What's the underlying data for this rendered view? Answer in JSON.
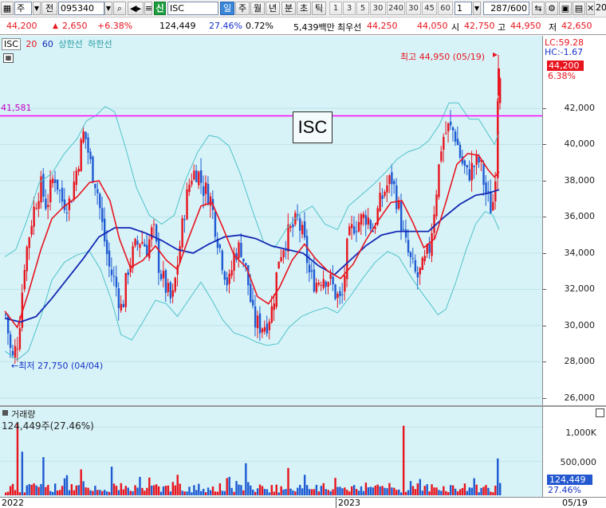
{
  "toolbar": {
    "market": "주",
    "prev_label": "전",
    "code": "095340",
    "name_tag": "신",
    "name": "ISC",
    "periods": [
      "일",
      "주",
      "월",
      "년",
      "분",
      "초",
      "틱"
    ],
    "active_period": "일",
    "numbers": [
      "1",
      "3",
      "5",
      "30",
      "240",
      "30",
      "45",
      "60"
    ],
    "unit": "1",
    "page_count": "287/600",
    "right_edge": "20"
  },
  "quote": {
    "price": "44,200",
    "change": "2,650",
    "change_pct": "+6.38%",
    "volume": "124,449",
    "vol_ratio": "27.46%",
    "turnover_pct": "0.72%",
    "amount": "5,439백만",
    "best_bid_label": "최우선",
    "best_ask": "44,250",
    "best_bid": "44,050",
    "open_label": "시",
    "open": "42,750",
    "high_label": "고",
    "high": "44,950",
    "low_label": "저",
    "low": "42,650"
  },
  "legend": {
    "name": "ISC",
    "ma1": "20",
    "ma2": "60",
    "upper": "상한선",
    "lower": "하한선"
  },
  "chart_title": "ISC",
  "right_info": {
    "lc": "LC:59.28",
    "hc": "HC:-1.67"
  },
  "price_badge": {
    "price": "44,200",
    "pct": "6.38%"
  },
  "annotations": {
    "high": "최고 44,950 (05/19)",
    "low": "최저 27,750 (04/04)",
    "line_label": "41,581"
  },
  "volume_legend": {
    "title": "거래량",
    "value": "124,449주(27.46%)"
  },
  "volume_badge": {
    "value": "124,449",
    "pct": "27.46%"
  },
  "volume_axis": [
    "1,000K",
    "500,000",
    "0"
  ],
  "date_labels": [
    "2022",
    "2023",
    "05/19"
  ],
  "colors": {
    "up": "#e8141e",
    "down": "#1e5ad2",
    "ma20": "#e8141e",
    "ma60": "#1428b4",
    "band": "#4fc3c8",
    "hline": "#ff00ff",
    "bg": "#d7f3f8"
  },
  "chart_data": {
    "type": "candlestick",
    "y_axis_labels": [
      "42,000",
      "40,000",
      "38,000",
      "36,000",
      "34,000",
      "32,000",
      "30,000",
      "28,000",
      "26,000"
    ],
    "ylim": [
      25600,
      46000
    ],
    "horizontal_line": 41581,
    "x_range": [
      "2022",
      "05/19"
    ],
    "period_high": 44950,
    "period_low": 27750,
    "close_path": [
      [
        0,
        30600
      ],
      [
        8,
        28000
      ],
      [
        16,
        29300
      ],
      [
        24,
        33500
      ],
      [
        34,
        36100
      ],
      [
        44,
        37800
      ],
      [
        52,
        36600
      ],
      [
        62,
        38400
      ],
      [
        72,
        36900
      ],
      [
        82,
        36800
      ],
      [
        92,
        39000
      ],
      [
        100,
        40800
      ],
      [
        108,
        38900
      ],
      [
        116,
        37700
      ],
      [
        124,
        35200
      ],
      [
        132,
        33200
      ],
      [
        140,
        32300
      ],
      [
        148,
        30800
      ],
      [
        156,
        33200
      ],
      [
        164,
        34200
      ],
      [
        172,
        34800
      ],
      [
        180,
        34300
      ],
      [
        188,
        35400
      ],
      [
        196,
        33100
      ],
      [
        204,
        32100
      ],
      [
        212,
        31200
      ],
      [
        220,
        33800
      ],
      [
        228,
        36400
      ],
      [
        236,
        38300
      ],
      [
        244,
        38600
      ],
      [
        252,
        37600
      ],
      [
        260,
        37200
      ],
      [
        268,
        35300
      ],
      [
        276,
        33600
      ],
      [
        284,
        32100
      ],
      [
        292,
        34100
      ],
      [
        300,
        34300
      ],
      [
        308,
        32600
      ],
      [
        316,
        30200
      ],
      [
        324,
        30000
      ],
      [
        332,
        30100
      ],
      [
        340,
        31000
      ],
      [
        348,
        33800
      ],
      [
        356,
        34700
      ],
      [
        364,
        35300
      ],
      [
        372,
        35800
      ],
      [
        380,
        34700
      ],
      [
        388,
        32600
      ],
      [
        396,
        32400
      ],
      [
        404,
        32800
      ],
      [
        412,
        32600
      ],
      [
        420,
        31800
      ],
      [
        428,
        31200
      ],
      [
        436,
        34600
      ],
      [
        444,
        35600
      ],
      [
        452,
        35800
      ],
      [
        460,
        36100
      ],
      [
        468,
        35300
      ],
      [
        476,
        36600
      ],
      [
        484,
        37600
      ],
      [
        492,
        38100
      ],
      [
        500,
        36700
      ],
      [
        508,
        34700
      ],
      [
        516,
        33500
      ],
      [
        524,
        32600
      ],
      [
        532,
        33200
      ],
      [
        540,
        34300
      ],
      [
        548,
        37200
      ],
      [
        556,
        40300
      ],
      [
        564,
        40900
      ],
      [
        572,
        40700
      ],
      [
        580,
        39200
      ],
      [
        588,
        38300
      ],
      [
        596,
        38800
      ],
      [
        604,
        39100
      ],
      [
        612,
        37300
      ],
      [
        620,
        36300
      ],
      [
        624,
        38600
      ],
      [
        628,
        44200
      ]
    ],
    "ma20_path": [
      [
        0,
        30800
      ],
      [
        16,
        29900
      ],
      [
        30,
        31800
      ],
      [
        46,
        34200
      ],
      [
        60,
        35900
      ],
      [
        76,
        36600
      ],
      [
        92,
        37100
      ],
      [
        108,
        37900
      ],
      [
        120,
        38000
      ],
      [
        134,
        36900
      ],
      [
        146,
        34800
      ],
      [
        160,
        33200
      ],
      [
        176,
        33600
      ],
      [
        192,
        34400
      ],
      [
        206,
        33600
      ],
      [
        220,
        33100
      ],
      [
        234,
        34800
      ],
      [
        250,
        36600
      ],
      [
        264,
        36800
      ],
      [
        278,
        35400
      ],
      [
        292,
        33900
      ],
      [
        308,
        33200
      ],
      [
        322,
        31600
      ],
      [
        336,
        31200
      ],
      [
        350,
        32100
      ],
      [
        366,
        33600
      ],
      [
        382,
        34500
      ],
      [
        396,
        33700
      ],
      [
        412,
        33000
      ],
      [
        428,
        32600
      ],
      [
        444,
        33400
      ],
      [
        460,
        34700
      ],
      [
        476,
        35800
      ],
      [
        492,
        36800
      ],
      [
        506,
        36900
      ],
      [
        520,
        35700
      ],
      [
        534,
        34300
      ],
      [
        548,
        34800
      ],
      [
        562,
        36800
      ],
      [
        576,
        38900
      ],
      [
        590,
        39500
      ],
      [
        604,
        39400
      ],
      [
        616,
        38600
      ],
      [
        624,
        38200
      ],
      [
        630,
        38500
      ]
    ],
    "ma60_path": [
      [
        0,
        30400
      ],
      [
        20,
        30200
      ],
      [
        40,
        30500
      ],
      [
        60,
        31500
      ],
      [
        80,
        32600
      ],
      [
        100,
        33700
      ],
      [
        120,
        34900
      ],
      [
        140,
        35400
      ],
      [
        160,
        35400
      ],
      [
        180,
        35100
      ],
      [
        200,
        34700
      ],
      [
        220,
        34200
      ],
      [
        240,
        34000
      ],
      [
        260,
        34500
      ],
      [
        280,
        34900
      ],
      [
        300,
        35000
      ],
      [
        320,
        34800
      ],
      [
        340,
        34400
      ],
      [
        360,
        34200
      ],
      [
        380,
        34000
      ],
      [
        400,
        33300
      ],
      [
        420,
        32800
      ],
      [
        440,
        33600
      ],
      [
        460,
        34400
      ],
      [
        480,
        35000
      ],
      [
        500,
        35200
      ],
      [
        520,
        35200
      ],
      [
        540,
        35200
      ],
      [
        560,
        36000
      ],
      [
        580,
        36700
      ],
      [
        600,
        37200
      ],
      [
        615,
        37300
      ],
      [
        630,
        37500
      ]
    ],
    "upper_band": [
      [
        0,
        33800
      ],
      [
        14,
        34200
      ],
      [
        28,
        35800
      ],
      [
        44,
        37900
      ],
      [
        60,
        38400
      ],
      [
        76,
        39500
      ],
      [
        92,
        40300
      ],
      [
        104,
        41300
      ],
      [
        116,
        41600
      ],
      [
        128,
        42100
      ],
      [
        140,
        41800
      ],
      [
        154,
        39800
      ],
      [
        168,
        37600
      ],
      [
        184,
        36100
      ],
      [
        200,
        35600
      ],
      [
        216,
        36100
      ],
      [
        230,
        38000
      ],
      [
        246,
        39600
      ],
      [
        260,
        40500
      ],
      [
        272,
        40400
      ],
      [
        286,
        39900
      ],
      [
        300,
        38400
      ],
      [
        316,
        36300
      ],
      [
        330,
        34600
      ],
      [
        344,
        34300
      ],
      [
        360,
        35400
      ],
      [
        376,
        36200
      ],
      [
        392,
        36600
      ],
      [
        408,
        35600
      ],
      [
        424,
        35300
      ],
      [
        438,
        36600
      ],
      [
        454,
        37200
      ],
      [
        470,
        37800
      ],
      [
        486,
        38500
      ],
      [
        500,
        39200
      ],
      [
        514,
        39600
      ],
      [
        528,
        39800
      ],
      [
        540,
        40200
      ],
      [
        554,
        41100
      ],
      [
        566,
        42300
      ],
      [
        578,
        42300
      ],
      [
        592,
        41400
      ],
      [
        604,
        41400
      ],
      [
        614,
        40700
      ],
      [
        624,
        40000
      ],
      [
        630,
        40700
      ]
    ],
    "lower_band": [
      [
        0,
        28600
      ],
      [
        16,
        28100
      ],
      [
        30,
        28600
      ],
      [
        46,
        30500
      ],
      [
        60,
        32500
      ],
      [
        76,
        33500
      ],
      [
        92,
        33900
      ],
      [
        108,
        34100
      ],
      [
        122,
        33100
      ],
      [
        136,
        31400
      ],
      [
        148,
        29500
      ],
      [
        162,
        29200
      ],
      [
        176,
        30200
      ],
      [
        192,
        31400
      ],
      [
        206,
        31200
      ],
      [
        220,
        30500
      ],
      [
        234,
        31400
      ],
      [
        250,
        32400
      ],
      [
        264,
        31400
      ],
      [
        278,
        30300
      ],
      [
        292,
        29600
      ],
      [
        306,
        29400
      ],
      [
        320,
        29100
      ],
      [
        334,
        28900
      ],
      [
        348,
        29000
      ],
      [
        362,
        29900
      ],
      [
        378,
        30500
      ],
      [
        394,
        30800
      ],
      [
        410,
        31000
      ],
      [
        424,
        30700
      ],
      [
        440,
        31600
      ],
      [
        456,
        32600
      ],
      [
        472,
        33500
      ],
      [
        488,
        34100
      ],
      [
        502,
        33800
      ],
      [
        516,
        32800
      ],
      [
        530,
        31900
      ],
      [
        542,
        31200
      ],
      [
        552,
        30600
      ],
      [
        562,
        30900
      ],
      [
        574,
        32300
      ],
      [
        588,
        34200
      ],
      [
        600,
        35600
      ],
      [
        612,
        36300
      ],
      [
        622,
        36100
      ],
      [
        630,
        35300
      ]
    ],
    "volume_ylim": [
      0,
      1250000
    ],
    "volume_spikes": [
      [
        14,
        1050000
      ],
      [
        22,
        640000
      ],
      [
        48,
        560000
      ],
      [
        96,
        380000
      ],
      [
        134,
        420000
      ],
      [
        218,
        300000
      ],
      [
        306,
        470000
      ],
      [
        360,
        400000
      ],
      [
        508,
        1020000
      ],
      [
        598,
        250000
      ],
      [
        628,
        540000
      ]
    ]
  }
}
